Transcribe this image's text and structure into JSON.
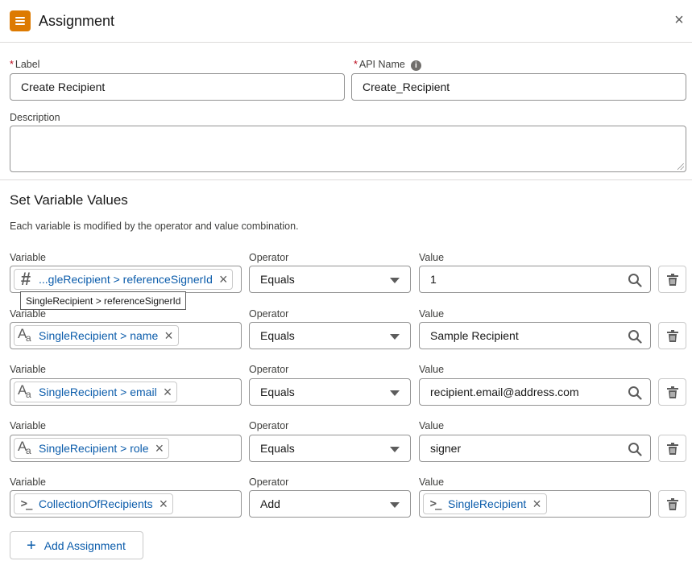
{
  "header": {
    "title": "Assignment",
    "app_icon": "menu-icon",
    "close_icon": "close-icon",
    "close_glyph": "×",
    "accent_color": "#dd7a01"
  },
  "form": {
    "required_marker": "*",
    "label": {
      "label": "Label",
      "value": "Create Recipient"
    },
    "api_name": {
      "label": "API Name",
      "value": "Create_Recipient",
      "info_icon": "info-icon"
    },
    "description": {
      "label": "Description",
      "value": ""
    }
  },
  "section": {
    "title": "Set Variable Values",
    "description": "Each variable is modified by the operator and value combination."
  },
  "rows": [
    {
      "variable_label": "Variable",
      "variable_icon": "number-icon",
      "variable_value": "...gleRecipient > referenceSignerId",
      "operator_label": "Operator",
      "operator": "Equals",
      "value_label": "Value",
      "value": "1",
      "value_type": "text"
    },
    {
      "variable_label": "Variable",
      "variable_icon": "text-icon",
      "variable_value": "SingleRecipient > name",
      "operator_label": "Operator",
      "operator": "Equals",
      "value_label": "Value",
      "value": "Sample Recipient",
      "value_type": "text"
    },
    {
      "variable_label": "Variable",
      "variable_icon": "text-icon",
      "variable_value": "SingleRecipient > email",
      "operator_label": "Operator",
      "operator": "Equals",
      "value_label": "Value",
      "value": "recipient.email@address.com",
      "value_type": "text"
    },
    {
      "variable_label": "Variable",
      "variable_icon": "text-icon",
      "variable_value": "SingleRecipient > role",
      "operator_label": "Operator",
      "operator": "Equals",
      "value_label": "Value",
      "value": "signer",
      "value_type": "text"
    },
    {
      "variable_label": "Variable",
      "variable_icon": "prompt-icon",
      "variable_value": "CollectionOfRecipients",
      "operator_label": "Operator",
      "operator": "Add",
      "value_label": "Value",
      "value": "SingleRecipient",
      "value_type": "pill",
      "value_icon": "prompt-icon"
    }
  ],
  "tooltip": {
    "text": "SingleRecipient > referenceSignerId"
  },
  "add_button": {
    "label": "Add Assignment",
    "icon": "plus-icon",
    "glyph": "+"
  },
  "colors": {
    "link": "#0b5cab",
    "required": "#ba0517",
    "border": "#939393"
  }
}
